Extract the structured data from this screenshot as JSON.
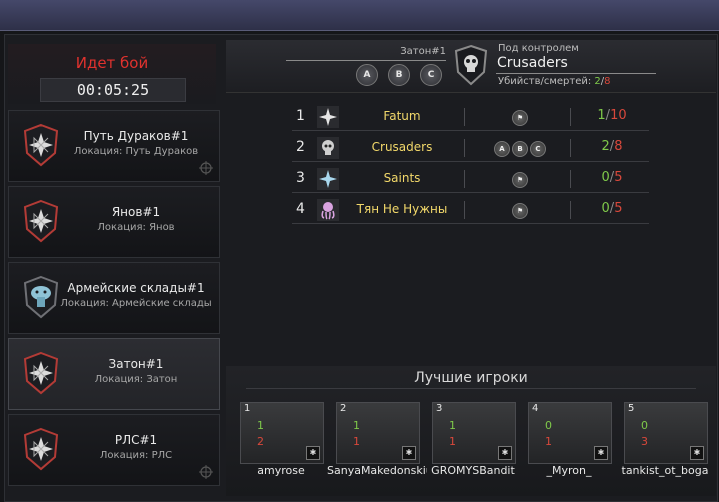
{
  "battle": {
    "status": "Идет бой",
    "timer": "00:05:25"
  },
  "locations": [
    {
      "name": "Путь Дураков#1",
      "sub": "Локация: Путь Дураков",
      "icon": "compass-star-icon",
      "active": false
    },
    {
      "name": "Янов#1",
      "sub": "Локация: Янов",
      "icon": "compass-star-icon",
      "active": false
    },
    {
      "name": "Армейские склады#1",
      "sub": "Локация: Армейские склады",
      "icon": "mushroom-icon",
      "active": false
    },
    {
      "name": "Затон#1",
      "sub": "Локация: Затон",
      "icon": "compass-star-icon",
      "active": true
    },
    {
      "name": "РЛС#1",
      "sub": "Локация: РЛС",
      "icon": "compass-star-icon",
      "active": false
    }
  ],
  "header": {
    "zone": "Затон#1",
    "points": [
      "A",
      "B",
      "C"
    ],
    "control_label": "Под контролем",
    "controller": "Crusaders",
    "stats_label": "Убийств/смертей:",
    "kills": "2",
    "deaths": "8"
  },
  "teams": [
    {
      "rank": "1",
      "name": "Fatum",
      "flags": [],
      "kills": "1",
      "deaths": "10",
      "icon": "compass-star-icon"
    },
    {
      "rank": "2",
      "name": "Crusaders",
      "flags": [
        "A",
        "B",
        "C"
      ],
      "kills": "2",
      "deaths": "8",
      "icon": "skull-icon"
    },
    {
      "rank": "3",
      "name": "Saints",
      "flags": [],
      "kills": "0",
      "deaths": "5",
      "icon": "compass-star-icon"
    },
    {
      "rank": "4",
      "name": "Тян Не Нужны",
      "flags": [],
      "kills": "0",
      "deaths": "5",
      "icon": "octopus-icon"
    }
  ],
  "best_players": {
    "title": "Лучшие игроки",
    "players": [
      {
        "rank": "1",
        "name": "amyrose",
        "kills": "1",
        "deaths": "2"
      },
      {
        "rank": "2",
        "name": "SanyaMakedonskiu",
        "kills": "1",
        "deaths": "1"
      },
      {
        "rank": "3",
        "name": "GROMYSBandit",
        "kills": "1",
        "deaths": "1"
      },
      {
        "rank": "4",
        "name": "_Myron_",
        "kills": "0",
        "deaths": "1"
      },
      {
        "rank": "5",
        "name": "tankist_ot_boga",
        "kills": "0",
        "deaths": "3"
      }
    ]
  },
  "colors": {
    "accent_red": "#e0322e",
    "team_yellow": "#f2d86a",
    "kills_green": "#7fc94a",
    "deaths_red": "#d9483b"
  }
}
